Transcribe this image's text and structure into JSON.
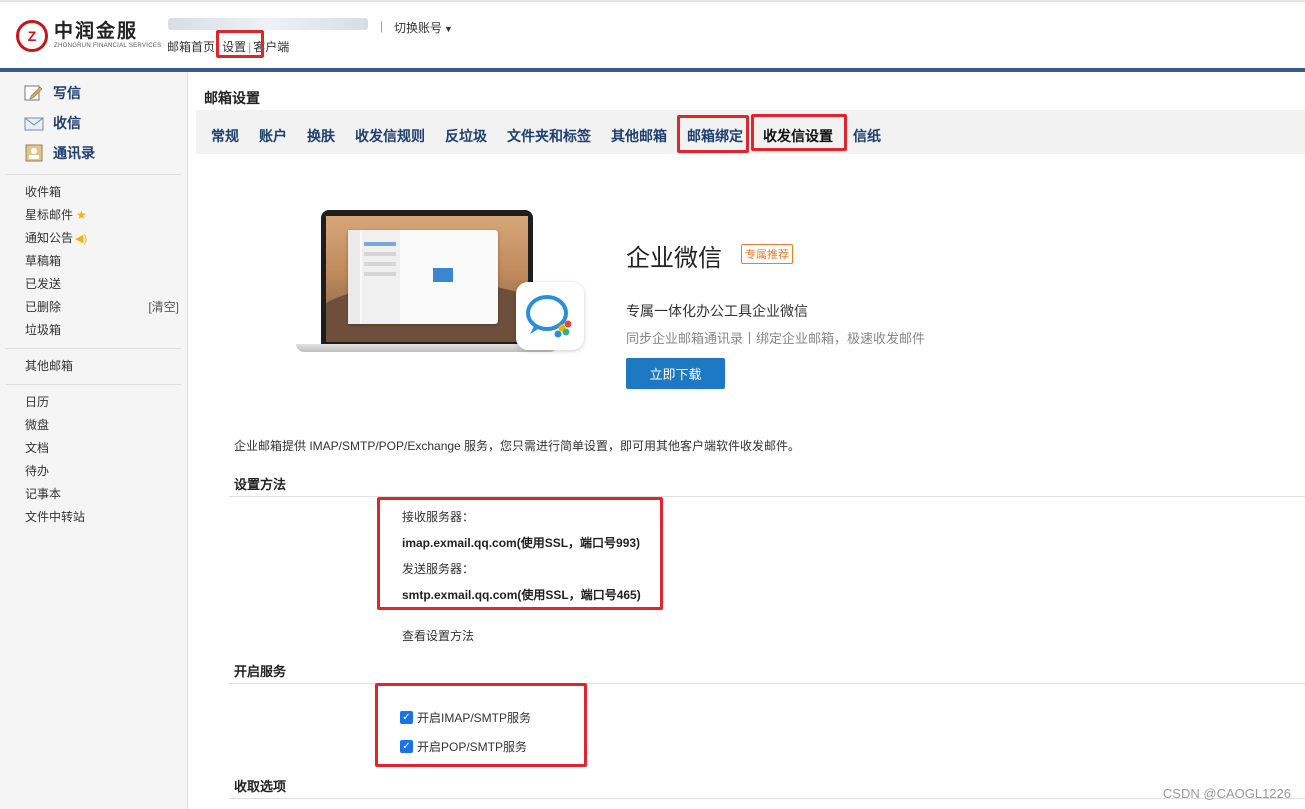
{
  "header": {
    "logo_cn": "中润金服",
    "logo_en": "ZHONGRUN FINANCIAL SERVICES",
    "switch_account": "切换账号",
    "links": [
      "邮箱首页",
      "设置",
      "客户端"
    ]
  },
  "sidebar": {
    "primary": [
      {
        "label": "写信",
        "icon": "pencil-icon"
      },
      {
        "label": "收信",
        "icon": "inbox-icon"
      },
      {
        "label": "通讯录",
        "icon": "contacts-icon"
      }
    ],
    "folders": [
      "收件箱",
      "星标邮件",
      "通知公告",
      "草稿箱",
      "已发送",
      "已删除",
      "垃圾箱"
    ],
    "clear_label": "[清空]",
    "other_mail": "其他邮箱",
    "apps": [
      "日历",
      "微盘",
      "文档",
      "待办",
      "记事本",
      "文件中转站"
    ]
  },
  "main": {
    "page_title": "邮箱设置",
    "tabs": [
      "常规",
      "账户",
      "换肤",
      "收发信规则",
      "反垃圾",
      "文件夹和标签",
      "其他邮箱",
      "邮箱绑定",
      "收发信设置",
      "信纸"
    ],
    "active_tab": "收发信设置"
  },
  "promo": {
    "title": "企业微信",
    "badge": "专属推荐",
    "subtitle": "专属一体化办公工具企业微信",
    "desc": "同步企业邮箱通讯录丨绑定企业邮箱，极速收发邮件",
    "download": "立即下载"
  },
  "settings": {
    "intro": "企业邮箱提供 IMAP/SMTP/POP/Exchange 服务，您只需进行简单设置，即可用其他客户端软件收发邮件。",
    "method_title": "设置方法",
    "recv_label": "接收服务器：",
    "recv_value": "imap.exmail.qq.com(使用SSL，端口号993)",
    "send_label": "发送服务器：",
    "send_value": "smtp.exmail.qq.com(使用SSL，端口号465)",
    "view_method": "查看设置方法",
    "service_title": "开启服务",
    "imap_label": "开启IMAP/SMTP服务",
    "pop_label": "开启POP/SMTP服务",
    "receive_title": "收取选项"
  },
  "watermark": "CSDN @CAOGL1226"
}
